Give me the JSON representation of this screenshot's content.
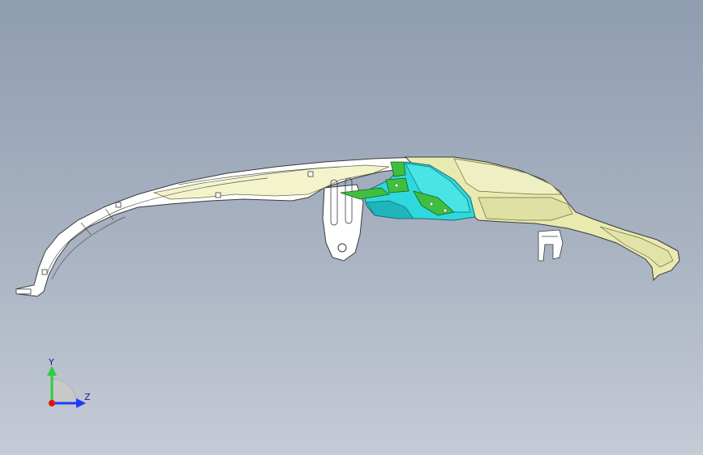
{
  "app": {
    "title": ""
  },
  "viewport": {
    "background_top": "#8f9db1",
    "background_bottom": "#c6cbd6"
  },
  "model": {
    "colors": {
      "shell": "#ffffff",
      "shell_outline": "#3a3a3a",
      "shell_shade": "#eef0b8",
      "cover": "#e9eab0",
      "cover_dark": "#d8d998",
      "bracket_cyan": "#2fd8dc",
      "bracket_cyan_dark": "#1fb5bc",
      "plate_green": "#3fbf3f"
    }
  },
  "triad": {
    "y_label": "Y",
    "z_label": "Z",
    "y_color": "#2ecc40",
    "z_color": "#1a3cff",
    "origin_color": "#e01010"
  }
}
